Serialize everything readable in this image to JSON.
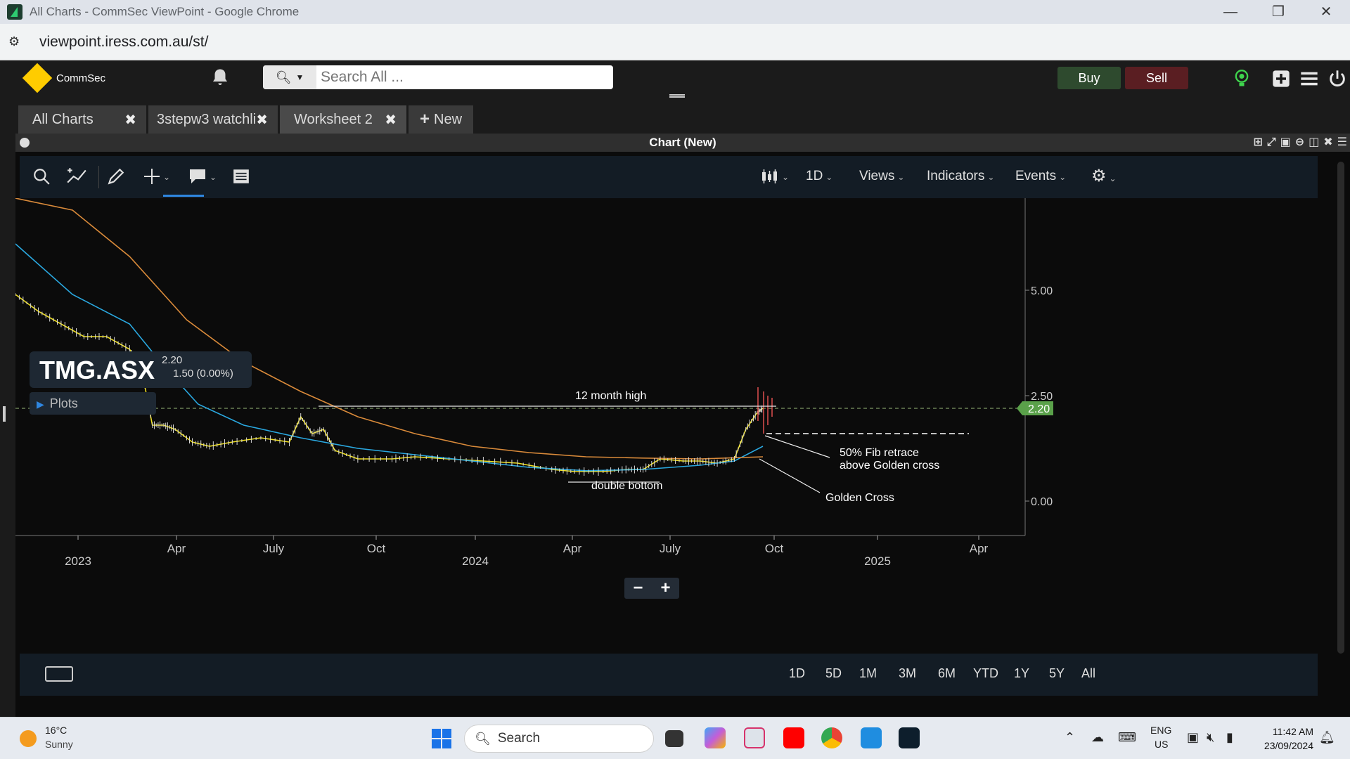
{
  "window": {
    "title": "All Charts - CommSec ViewPoint - Google Chrome",
    "url": "viewpoint.iress.com.au/st/"
  },
  "header": {
    "brand": "CommSec",
    "search_placeholder": "Search All ...",
    "buy_label": "Buy",
    "sell_label": "Sell"
  },
  "tabs": [
    {
      "label": "All Charts"
    },
    {
      "label": "3stepw3 watchli"
    },
    {
      "label": "Worksheet 2"
    }
  ],
  "new_tab_label": "New",
  "panel": {
    "title": "Chart (New)"
  },
  "toolbar": {
    "interval": "1D",
    "views": "Views",
    "indicators": "Indicators",
    "events": "Events"
  },
  "ticker": {
    "symbol": "TMG.ASX",
    "price": "2.20",
    "change": "1.50 (0.00%)",
    "plots_label": "Plots"
  },
  "chart_data": {
    "type": "line",
    "symbol": "TMG.ASX",
    "y_ticks": [
      "5.00",
      "2.50",
      "0.00"
    ],
    "ylim": [
      0,
      5
    ],
    "x_ticks_month": [
      "Apr",
      "July",
      "Oct",
      "Apr",
      "July",
      "Oct",
      "Apr"
    ],
    "x_ticks_year": [
      "2023",
      "2024",
      "2025"
    ],
    "current_price_label": "2.20",
    "series": [
      {
        "name": "price",
        "color": "#f0e020",
        "points": [
          [
            0,
            4.9
          ],
          [
            8,
            4.5
          ],
          [
            16,
            4.2
          ],
          [
            24,
            3.9
          ],
          [
            32,
            3.9
          ],
          [
            40,
            3.6
          ],
          [
            44,
            3.2
          ],
          [
            48,
            1.8
          ],
          [
            52,
            1.8
          ],
          [
            56,
            1.7
          ],
          [
            62,
            1.4
          ],
          [
            68,
            1.3
          ],
          [
            76,
            1.4
          ],
          [
            86,
            1.5
          ],
          [
            96,
            1.4
          ],
          [
            100,
            2.0
          ],
          [
            104,
            1.6
          ],
          [
            108,
            1.7
          ],
          [
            112,
            1.2
          ],
          [
            120,
            1.0
          ],
          [
            132,
            1.0
          ],
          [
            140,
            1.05
          ],
          [
            152,
            1.0
          ],
          [
            164,
            0.95
          ],
          [
            176,
            0.9
          ],
          [
            188,
            0.75
          ],
          [
            196,
            0.7
          ],
          [
            206,
            0.7
          ],
          [
            214,
            0.75
          ],
          [
            220,
            0.75
          ],
          [
            226,
            1.0
          ],
          [
            234,
            0.95
          ],
          [
            240,
            0.95
          ],
          [
            246,
            0.9
          ],
          [
            252,
            1.0
          ],
          [
            256,
            1.7
          ],
          [
            260,
            2.1
          ],
          [
            262,
            2.2
          ]
        ]
      },
      {
        "name": "ma-blue",
        "color": "#2aa8e0",
        "points": [
          [
            0,
            6.1
          ],
          [
            20,
            4.9
          ],
          [
            40,
            4.2
          ],
          [
            52,
            3.2
          ],
          [
            64,
            2.3
          ],
          [
            80,
            1.8
          ],
          [
            100,
            1.5
          ],
          [
            120,
            1.25
          ],
          [
            140,
            1.1
          ],
          [
            160,
            0.95
          ],
          [
            180,
            0.8
          ],
          [
            200,
            0.72
          ],
          [
            220,
            0.75
          ],
          [
            240,
            0.85
          ],
          [
            252,
            0.95
          ],
          [
            262,
            1.3
          ]
        ]
      },
      {
        "name": "ma-orange",
        "color": "#d98a3a",
        "points": [
          [
            0,
            8.0
          ],
          [
            20,
            6.9
          ],
          [
            40,
            5.8
          ],
          [
            60,
            4.3
          ],
          [
            80,
            3.3
          ],
          [
            100,
            2.6
          ],
          [
            120,
            2.0
          ],
          [
            140,
            1.6
          ],
          [
            160,
            1.3
          ],
          [
            180,
            1.15
          ],
          [
            200,
            1.05
          ],
          [
            220,
            1.02
          ],
          [
            240,
            1.0
          ],
          [
            262,
            1.05
          ]
        ]
      }
    ],
    "annotations": [
      {
        "text": "12 month high"
      },
      {
        "text": "double bottom"
      },
      {
        "text": "50% Fib retrace"
      },
      {
        "text": "above Golden cross"
      },
      {
        "text": "Golden Cross"
      }
    ]
  },
  "range_buttons": [
    "1D",
    "5D",
    "1M",
    "3M",
    "6M",
    "YTD",
    "1Y",
    "5Y",
    "All"
  ],
  "taskbar": {
    "temperature": "16°C",
    "weather": "Sunny",
    "search_label": "Search",
    "lang": "ENG",
    "region": "US",
    "time": "11:42 AM",
    "date": "23/09/2024"
  }
}
